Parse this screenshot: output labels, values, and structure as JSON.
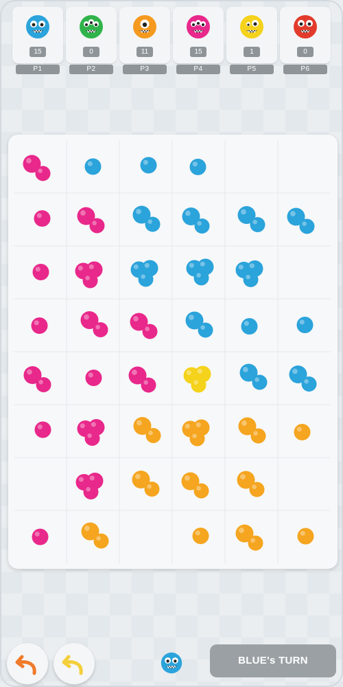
{
  "colors": {
    "blue": "#2ba3db",
    "pink": "#e8288b",
    "yellow": "#f5d21b",
    "orange": "#f5a51f",
    "green": "#2fb34a",
    "red": "#e33b2b"
  },
  "players": [
    {
      "name": "P1",
      "score": "15",
      "color": "#2ba3db",
      "icon": "blue-monster-icon"
    },
    {
      "name": "P2",
      "score": "0",
      "color": "#2fb34a",
      "icon": "green-monster-icon"
    },
    {
      "name": "P3",
      "score": "11",
      "color": "#f59a1f",
      "icon": "orange-monster-icon"
    },
    {
      "name": "P4",
      "score": "15",
      "color": "#e8288b",
      "icon": "pink-monster-icon"
    },
    {
      "name": "P5",
      "score": "1",
      "color": "#f5d21b",
      "icon": "yellow-monster-icon"
    },
    {
      "name": "P6",
      "score": "0",
      "color": "#e33b2b",
      "icon": "red-monster-icon"
    }
  ],
  "board": {
    "rows": 8,
    "cols": 6,
    "cells": [
      [
        "pink:2",
        "blue:1",
        "blue:1",
        "blue:1",
        "",
        ""
      ],
      [
        "pink:1",
        "pink:2",
        "blue:2",
        "blue:2",
        "blue:2",
        "blue:2"
      ],
      [
        "pink:1",
        "pink:3",
        "blue:3",
        "blue:3",
        "blue:3",
        ""
      ],
      [
        "pink:1",
        "pink:2",
        "pink:2",
        "blue:2",
        "blue:1",
        "blue:1"
      ],
      [
        "pink:2",
        "pink:1",
        "pink:2",
        "yellow:3",
        "blue:2",
        "blue:2"
      ],
      [
        "pink:1",
        "pink:3",
        "orange:2",
        "orange:3",
        "orange:2",
        "orange:1"
      ],
      [
        "",
        "pink:3",
        "orange:2",
        "orange:2",
        "orange:2",
        ""
      ],
      [
        "pink:1",
        "orange:2",
        "",
        "orange:1",
        "orange:2",
        "orange:1"
      ]
    ]
  },
  "controls": {
    "undo_icon": "undo-arrow-icon",
    "redo_icon": "redo-arrow-icon",
    "turn_text": "BLUE's TURN",
    "turn_player_icon": "blue-monster-icon"
  }
}
